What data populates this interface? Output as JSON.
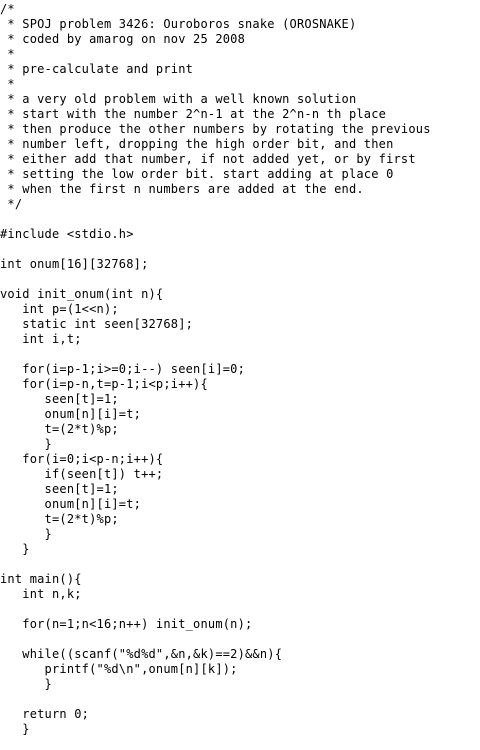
{
  "document": {
    "language": "C",
    "lines": [
      "/*",
      " * SPOJ problem 3426: Ouroboros snake (OROSNAKE)",
      " * coded by amarog on nov 25 2008",
      " *",
      " * pre-calculate and print",
      " *",
      " * a very old problem with a well known solution",
      " * start with the number 2^n-1 at the 2^n-n th place",
      " * then produce the other numbers by rotating the previous",
      " * number left, dropping the high order bit, and then",
      " * either add that number, if not added yet, or by first",
      " * setting the low order bit. start adding at place 0",
      " * when the first n numbers are added at the end.",
      " */",
      "",
      "#include <stdio.h>",
      "",
      "int onum[16][32768];",
      "",
      "void init_onum(int n){",
      "   int p=(1<<n);",
      "   static int seen[32768];",
      "   int i,t;",
      "",
      "   for(i=p-1;i>=0;i--) seen[i]=0;",
      "   for(i=p-n,t=p-1;i<p;i++){",
      "      seen[t]=1;",
      "      onum[n][i]=t;",
      "      t=(2*t)%p;",
      "      }",
      "   for(i=0;i<p-n;i++){",
      "      if(seen[t]) t++;",
      "      seen[t]=1;",
      "      onum[n][i]=t;",
      "      t=(2*t)%p;",
      "      }",
      "   }",
      "",
      "int main(){",
      "   int n,k;",
      "",
      "   for(n=1;n<16;n++) init_onum(n);",
      "",
      "   while((scanf(\"%d%d\",&n,&k)==2)&&n){",
      "      printf(\"%d\\n\",onum[n][k]);",
      "      }",
      "",
      "   return 0;",
      "   }"
    ]
  }
}
